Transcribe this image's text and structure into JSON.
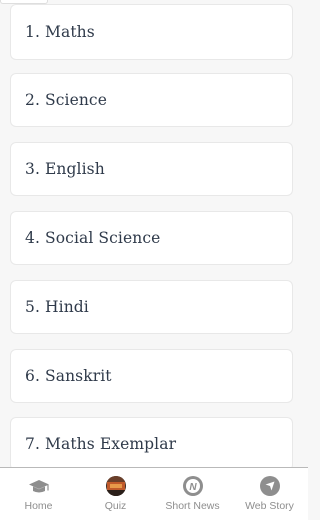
{
  "subjects": [
    {
      "label": "1. Maths"
    },
    {
      "label": "2. Science"
    },
    {
      "label": "3. English"
    },
    {
      "label": "4. Social Science"
    },
    {
      "label": "5. Hindi"
    },
    {
      "label": "6. Sanskrit"
    },
    {
      "label": "7. Maths Exemplar"
    }
  ],
  "bottom_nav": {
    "items": [
      {
        "label": "Home",
        "icon": "graduation-cap-icon"
      },
      {
        "label": "Quiz",
        "icon": "quiz-thumbnail-icon"
      },
      {
        "label": "Short News",
        "icon": "news-n-icon"
      },
      {
        "label": "Web Story",
        "icon": "compass-arrow-icon"
      }
    ]
  },
  "colors": {
    "background": "#f7f7f7",
    "card": "#ffffff",
    "text": "#2f3a4a",
    "nav_icon": "#8e8e8e",
    "nav_label": "#8e8e8e"
  }
}
